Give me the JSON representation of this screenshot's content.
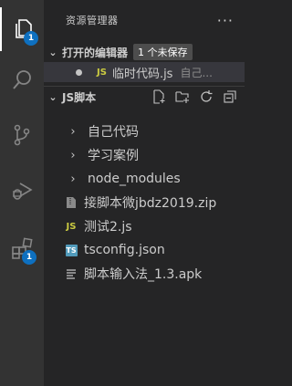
{
  "activity_bar": {
    "explorer_badge": "1",
    "extensions_badge": "1"
  },
  "sidebar": {
    "title": "资源管理器",
    "more": "···"
  },
  "open_editors": {
    "title": "打开的编辑器",
    "badge": "1 个未保存",
    "items": [
      {
        "icon": "JS",
        "name": "临时代码.js",
        "desc": "自己..."
      }
    ]
  },
  "explorer": {
    "title": "JS脚本",
    "items": [
      {
        "type": "folder",
        "name": "自己代码"
      },
      {
        "type": "folder",
        "name": "学习案例"
      },
      {
        "type": "folder",
        "name": "node_modules"
      },
      {
        "type": "file",
        "icon": "zip-file-icon",
        "name": "接脚本微jbdz2019.zip"
      },
      {
        "type": "file",
        "icon": "js-file-icon",
        "icon_text": "JS",
        "name": "测试2.js"
      },
      {
        "type": "file",
        "icon": "ts-file-icon",
        "icon_text": "TS",
        "name": "tsconfig.json"
      },
      {
        "type": "file",
        "icon": "text-file-icon",
        "name": "脚本输入法_1.3.apk"
      }
    ]
  },
  "colors": {
    "activity_bg": "#333333",
    "sidebar_bg": "#252526",
    "badge": "#0e70c0",
    "js_yellow": "#cbcb41",
    "ts_blue": "#519aba"
  }
}
